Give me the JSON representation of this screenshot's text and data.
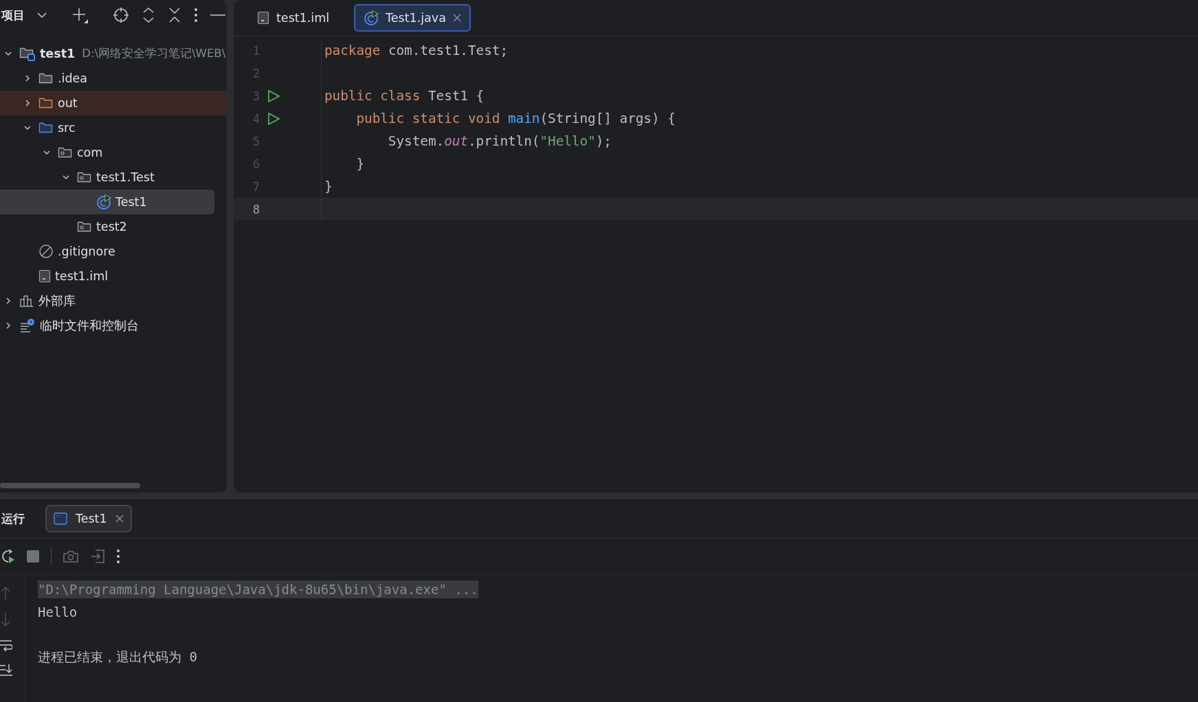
{
  "project_panel": {
    "title": "项目",
    "tree": [
      {
        "name": "test1",
        "kind": "module",
        "path": "D:\\网络安全学习笔记\\WEB\\",
        "expanded": true,
        "selected": false,
        "children": [
          {
            "name": ".idea",
            "kind": "folder",
            "expanded": false,
            "selected": false
          },
          {
            "name": "out",
            "kind": "excluded",
            "expanded": false,
            "selected": false
          },
          {
            "name": "src",
            "kind": "source",
            "expanded": true,
            "selected": false,
            "children": [
              {
                "name": "com",
                "kind": "package",
                "expanded": true,
                "selected": false,
                "children": [
                  {
                    "name": "test1.Test",
                    "kind": "package",
                    "expanded": true,
                    "selected": false,
                    "children": [
                      {
                        "name": "Test1",
                        "kind": "class",
                        "selected": true
                      }
                    ]
                  },
                  {
                    "name": "test2",
                    "kind": "package",
                    "selected": false
                  }
                ]
              }
            ]
          },
          {
            "name": ".gitignore",
            "kind": "ignore",
            "selected": false
          },
          {
            "name": "test1.iml",
            "kind": "iml",
            "selected": false
          }
        ]
      },
      {
        "name": "外部库",
        "kind": "library",
        "expanded": false,
        "selected": false
      },
      {
        "name": "临时文件和控制台",
        "kind": "scratch",
        "expanded": false,
        "selected": false
      }
    ]
  },
  "editor": {
    "tabs": [
      {
        "label": "test1.iml",
        "kind": "iml",
        "selected": false
      },
      {
        "label": "Test1.java",
        "kind": "class",
        "selected": true
      }
    ],
    "lines": [
      {
        "number": "1",
        "run": false,
        "current": false,
        "tokens": [
          {
            "text": "package ",
            "kind": "keyword"
          },
          {
            "text": "com.test1.Test;",
            "kind": "plain"
          }
        ]
      },
      {
        "number": "2",
        "run": false,
        "current": false
      },
      {
        "number": "3",
        "run": true,
        "current": false,
        "tokens": [
          {
            "text": "public class ",
            "kind": "keyword"
          },
          {
            "text": "Test1 {",
            "kind": "plain"
          }
        ]
      },
      {
        "number": "4",
        "run": true,
        "current": false,
        "tokens": [
          {
            "text": "    public static void ",
            "kind": "keyword"
          },
          {
            "text": "main",
            "kind": "method"
          },
          {
            "text": "(String[] args) {",
            "kind": "plain"
          }
        ]
      },
      {
        "number": "5",
        "run": false,
        "current": false,
        "tokens": [
          {
            "text": "        System.",
            "kind": "plain"
          },
          {
            "text": "out",
            "kind": "field"
          },
          {
            "text": ".println(",
            "kind": "plain"
          },
          {
            "text": "\"Hello\"",
            "kind": "string"
          },
          {
            "text": ");",
            "kind": "plain"
          }
        ]
      },
      {
        "number": "6",
        "run": false,
        "current": false,
        "tokens": [
          {
            "text": "    }",
            "kind": "plain"
          }
        ]
      },
      {
        "number": "7",
        "run": false,
        "current": false,
        "tokens": [
          {
            "text": "}",
            "kind": "plain"
          }
        ]
      },
      {
        "number": "8",
        "run": false,
        "current": true
      }
    ]
  },
  "run_panel": {
    "title": "运行",
    "tabs": [
      {
        "label": "Test1",
        "selected": true
      }
    ],
    "console": [
      {
        "text": "\"D:\\Programming Language\\Java\\jdk-8u65\\bin\\java.exe\" ...",
        "kind": "command"
      },
      {
        "text": "Hello",
        "kind": "output"
      },
      {
        "text": "进程已结束，退出代码为 0",
        "kind": "exit"
      }
    ]
  }
}
